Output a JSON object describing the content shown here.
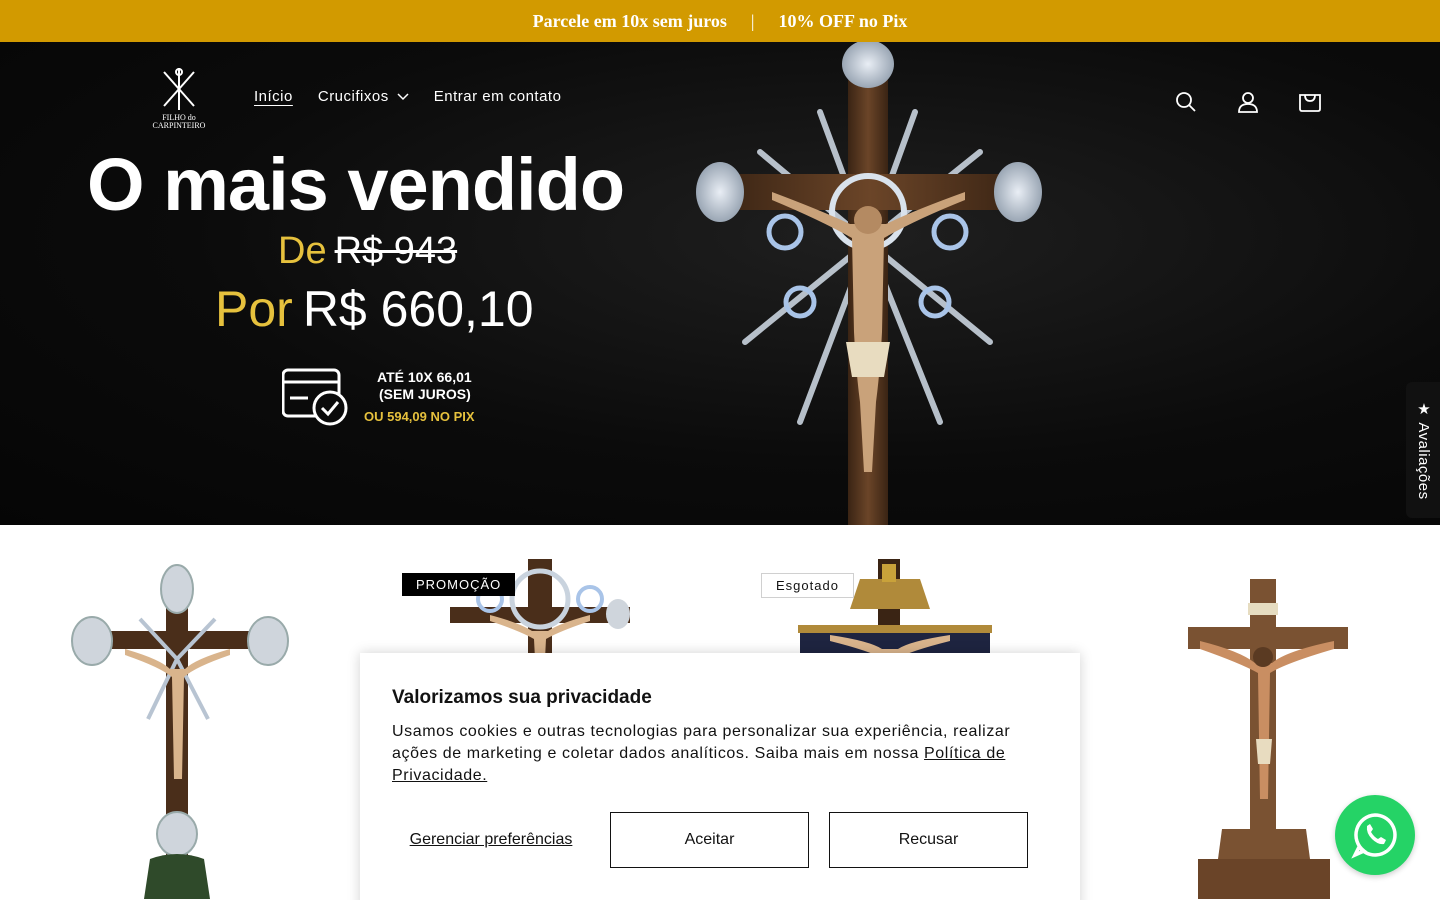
{
  "announcement": {
    "left": "Parcele em 10x sem juros",
    "separator": "|",
    "right": "10% OFF no Pix"
  },
  "header": {
    "logo_alt": "Filho do Carpinteiro",
    "nav": [
      {
        "label": "Início"
      },
      {
        "label": "Crucifixos"
      },
      {
        "label": "Entrar em contato"
      }
    ],
    "icons": [
      "search-icon",
      "account-icon",
      "cart-icon"
    ]
  },
  "hero": {
    "title": "O mais vendido",
    "from_label": "De",
    "old_price": "R$ 943",
    "por_label": "Por",
    "new_price": "R$ 660,10",
    "installments_line1": "ATÉ 10X 66,01",
    "installments_line2": "(SEM JUROS)",
    "pix_line": "OU 594,09 NO PIX"
  },
  "products": {
    "badges": {
      "promo": "PROMOÇÃO",
      "soldout": "Esgotado"
    }
  },
  "cookie": {
    "title": "Valorizamos sua privacidade",
    "body": "Usamos cookies e outras tecnologias para personalizar sua experiência, realizar ações de marketing e coletar dados analíticos. Saiba mais em nossa ",
    "link": "Política de Privacidade.",
    "manage": "Gerenciar preferências",
    "accept": "Aceitar",
    "reject": "Recusar"
  },
  "reviews_tab": {
    "label": "★ Avaliações"
  },
  "colors": {
    "announce_bg": "#d29a00",
    "gold_text": "#e6c13d",
    "whatsapp": "#25d366"
  }
}
